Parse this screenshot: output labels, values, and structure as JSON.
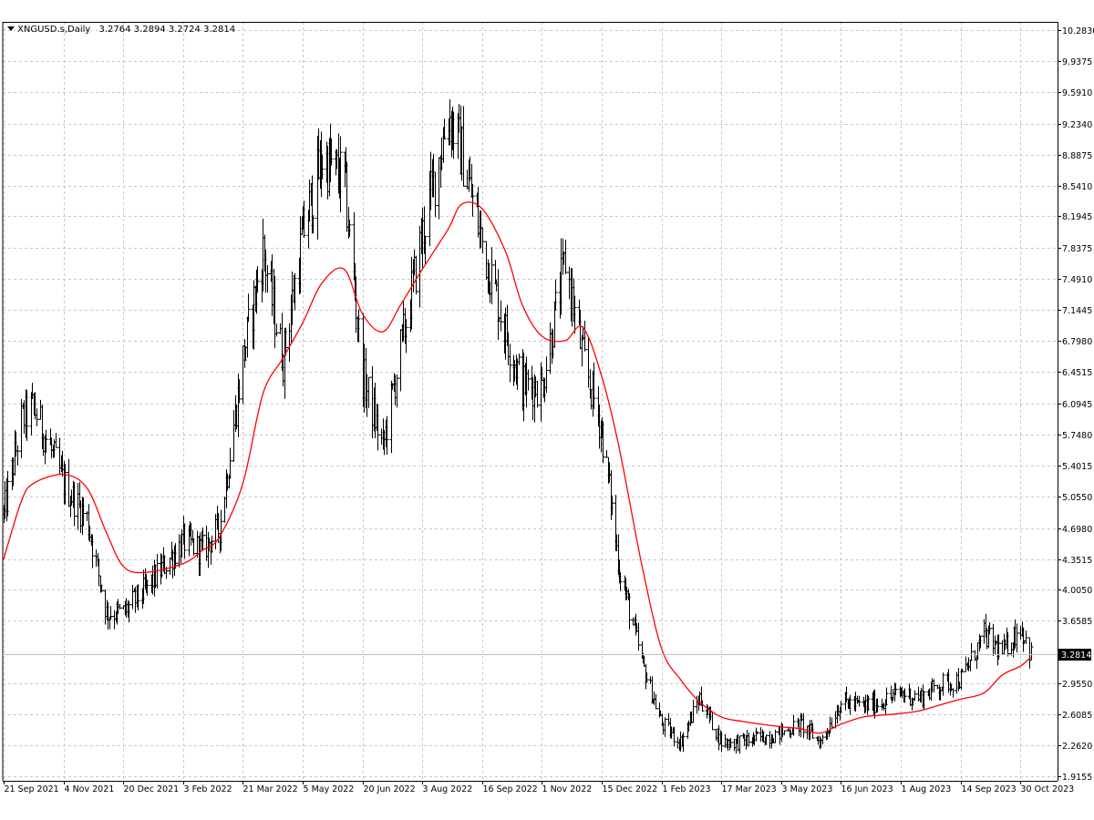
{
  "header": {
    "symbol": "XNGUSD.s,Daily",
    "open": "3.2764",
    "high": "3.2894",
    "low": "3.2724",
    "close": "3.2814"
  },
  "price_label": "3.2814",
  "colors": {
    "bars": "#000000",
    "ma": "#ff0000",
    "grid": "#c8c8c8",
    "background": "#ffffff",
    "price_box": "#000000"
  },
  "chart_data": {
    "type": "line",
    "title": "XNGUSD.s,Daily",
    "grid": true,
    "x_tick_labels": [
      "21 Sep 2021",
      "4 Nov 2021",
      "20 Dec 2021",
      "3 Feb 2022",
      "21 Mar 2022",
      "5 May 2022",
      "20 Jun 2022",
      "3 Aug 2022",
      "16 Sep 2022",
      "1 Nov 2022",
      "15 Dec 2022",
      "1 Feb 2023",
      "17 Mar 2023",
      "3 May 2023",
      "16 Jun 2023",
      "1 Aug 2023",
      "14 Sep 2023",
      "30 Oct 2023"
    ],
    "y_tick_labels": [
      "10.2830",
      "9.9375",
      "9.5910",
      "9.2340",
      "8.8875",
      "8.5410",
      "8.1945",
      "7.8375",
      "7.4910",
      "7.1445",
      "6.7980",
      "6.4515",
      "6.0945",
      "5.7480",
      "5.4015",
      "5.0550",
      "4.6980",
      "4.3515",
      "4.0050",
      "3.6585",
      "3.2814",
      "2.9550",
      "2.6085",
      "2.2620",
      "1.9155"
    ],
    "ylim": [
      1.9155,
      10.283
    ],
    "series": [
      {
        "name": "XNGUSD.s",
        "kind": "ohlc-bars",
        "x": [
          "21 Sep 2021",
          "4 Oct 2021",
          "13 Oct 2021",
          "4 Nov 2021",
          "22 Nov 2021",
          "7 Dec 2021",
          "20 Dec 2021",
          "5 Jan 2022",
          "3 Feb 2022",
          "18 Feb 2022",
          "3 Mar 2022",
          "21 Mar 2022",
          "5 Apr 2022",
          "20 Apr 2022",
          "5 May 2022",
          "20 May 2022",
          "6 Jun 2022",
          "20 Jun 2022",
          "5 Jul 2022",
          "18 Jul 2022",
          "3 Aug 2022",
          "22 Aug 2022",
          "1 Sep 2022",
          "16 Sep 2022",
          "4 Oct 2022",
          "17 Oct 2022",
          "1 Nov 2022",
          "18 Nov 2022",
          "1 Dec 2022",
          "15 Dec 2022",
          "29 Dec 2022",
          "16 Jan 2023",
          "1 Feb 2023",
          "15 Feb 2023",
          "1 Mar 2023",
          "17 Mar 2023",
          "3 Apr 2023",
          "17 Apr 2023",
          "3 May 2023",
          "17 May 2023",
          "1 Jun 2023",
          "16 Jun 2023",
          "3 Jul 2023",
          "17 Jul 2023",
          "1 Aug 2023",
          "15 Aug 2023",
          "31 Aug 2023",
          "14 Sep 2023",
          "2 Oct 2023",
          "16 Oct 2023",
          "30 Oct 2023",
          "7 Nov 2023"
        ],
        "y": [
          4.85,
          5.9,
          6.05,
          5.2,
          4.8,
          3.75,
          3.75,
          4.0,
          4.55,
          4.45,
          4.7,
          6.6,
          7.8,
          6.6,
          8.0,
          8.85,
          8.6,
          6.4,
          5.6,
          6.7,
          8.0,
          9.35,
          8.9,
          7.9,
          6.9,
          6.3,
          6.3,
          7.7,
          6.6,
          5.8,
          4.25,
          3.2,
          2.5,
          2.3,
          2.8,
          2.3,
          2.3,
          2.35,
          2.4,
          2.5,
          2.3,
          2.75,
          2.7,
          2.75,
          2.85,
          2.8,
          2.95,
          3.0,
          3.5,
          3.3,
          3.6,
          3.28
        ]
      },
      {
        "name": "Moving Average",
        "kind": "line",
        "x": [
          "21 Sep 2021",
          "4 Oct 2021",
          "13 Oct 2021",
          "4 Nov 2021",
          "22 Nov 2021",
          "7 Dec 2021",
          "20 Dec 2021",
          "5 Jan 2022",
          "3 Feb 2022",
          "18 Feb 2022",
          "3 Mar 2022",
          "21 Mar 2022",
          "5 Apr 2022",
          "20 Apr 2022",
          "5 May 2022",
          "20 May 2022",
          "6 Jun 2022",
          "20 Jun 2022",
          "5 Jul 2022",
          "18 Jul 2022",
          "3 Aug 2022",
          "22 Aug 2022",
          "1 Sep 2022",
          "16 Sep 2022",
          "4 Oct 2022",
          "17 Oct 2022",
          "1 Nov 2022",
          "18 Nov 2022",
          "1 Dec 2022",
          "15 Dec 2022",
          "29 Dec 2022",
          "16 Jan 2023",
          "1 Feb 2023",
          "15 Feb 2023",
          "1 Mar 2023",
          "17 Mar 2023",
          "3 Apr 2023",
          "17 Apr 2023",
          "3 May 2023",
          "17 May 2023",
          "1 Jun 2023",
          "16 Jun 2023",
          "3 Jul 2023",
          "17 Jul 2023",
          "1 Aug 2023",
          "15 Aug 2023",
          "31 Aug 2023",
          "14 Sep 2023",
          "2 Oct 2023",
          "16 Oct 2023",
          "30 Oct 2023",
          "7 Nov 2023"
        ],
        "y": [
          4.35,
          5.0,
          5.2,
          5.3,
          5.15,
          4.65,
          4.27,
          4.2,
          4.3,
          4.45,
          4.6,
          5.2,
          6.2,
          6.6,
          7.0,
          7.45,
          7.6,
          7.1,
          6.9,
          7.2,
          7.6,
          8.05,
          8.33,
          8.28,
          7.8,
          7.2,
          6.85,
          6.8,
          6.95,
          6.4,
          5.6,
          4.3,
          3.35,
          3.0,
          2.75,
          2.58,
          2.53,
          2.5,
          2.47,
          2.45,
          2.4,
          2.5,
          2.58,
          2.6,
          2.62,
          2.65,
          2.72,
          2.78,
          2.85,
          3.05,
          3.15,
          3.25
        ]
      }
    ]
  }
}
